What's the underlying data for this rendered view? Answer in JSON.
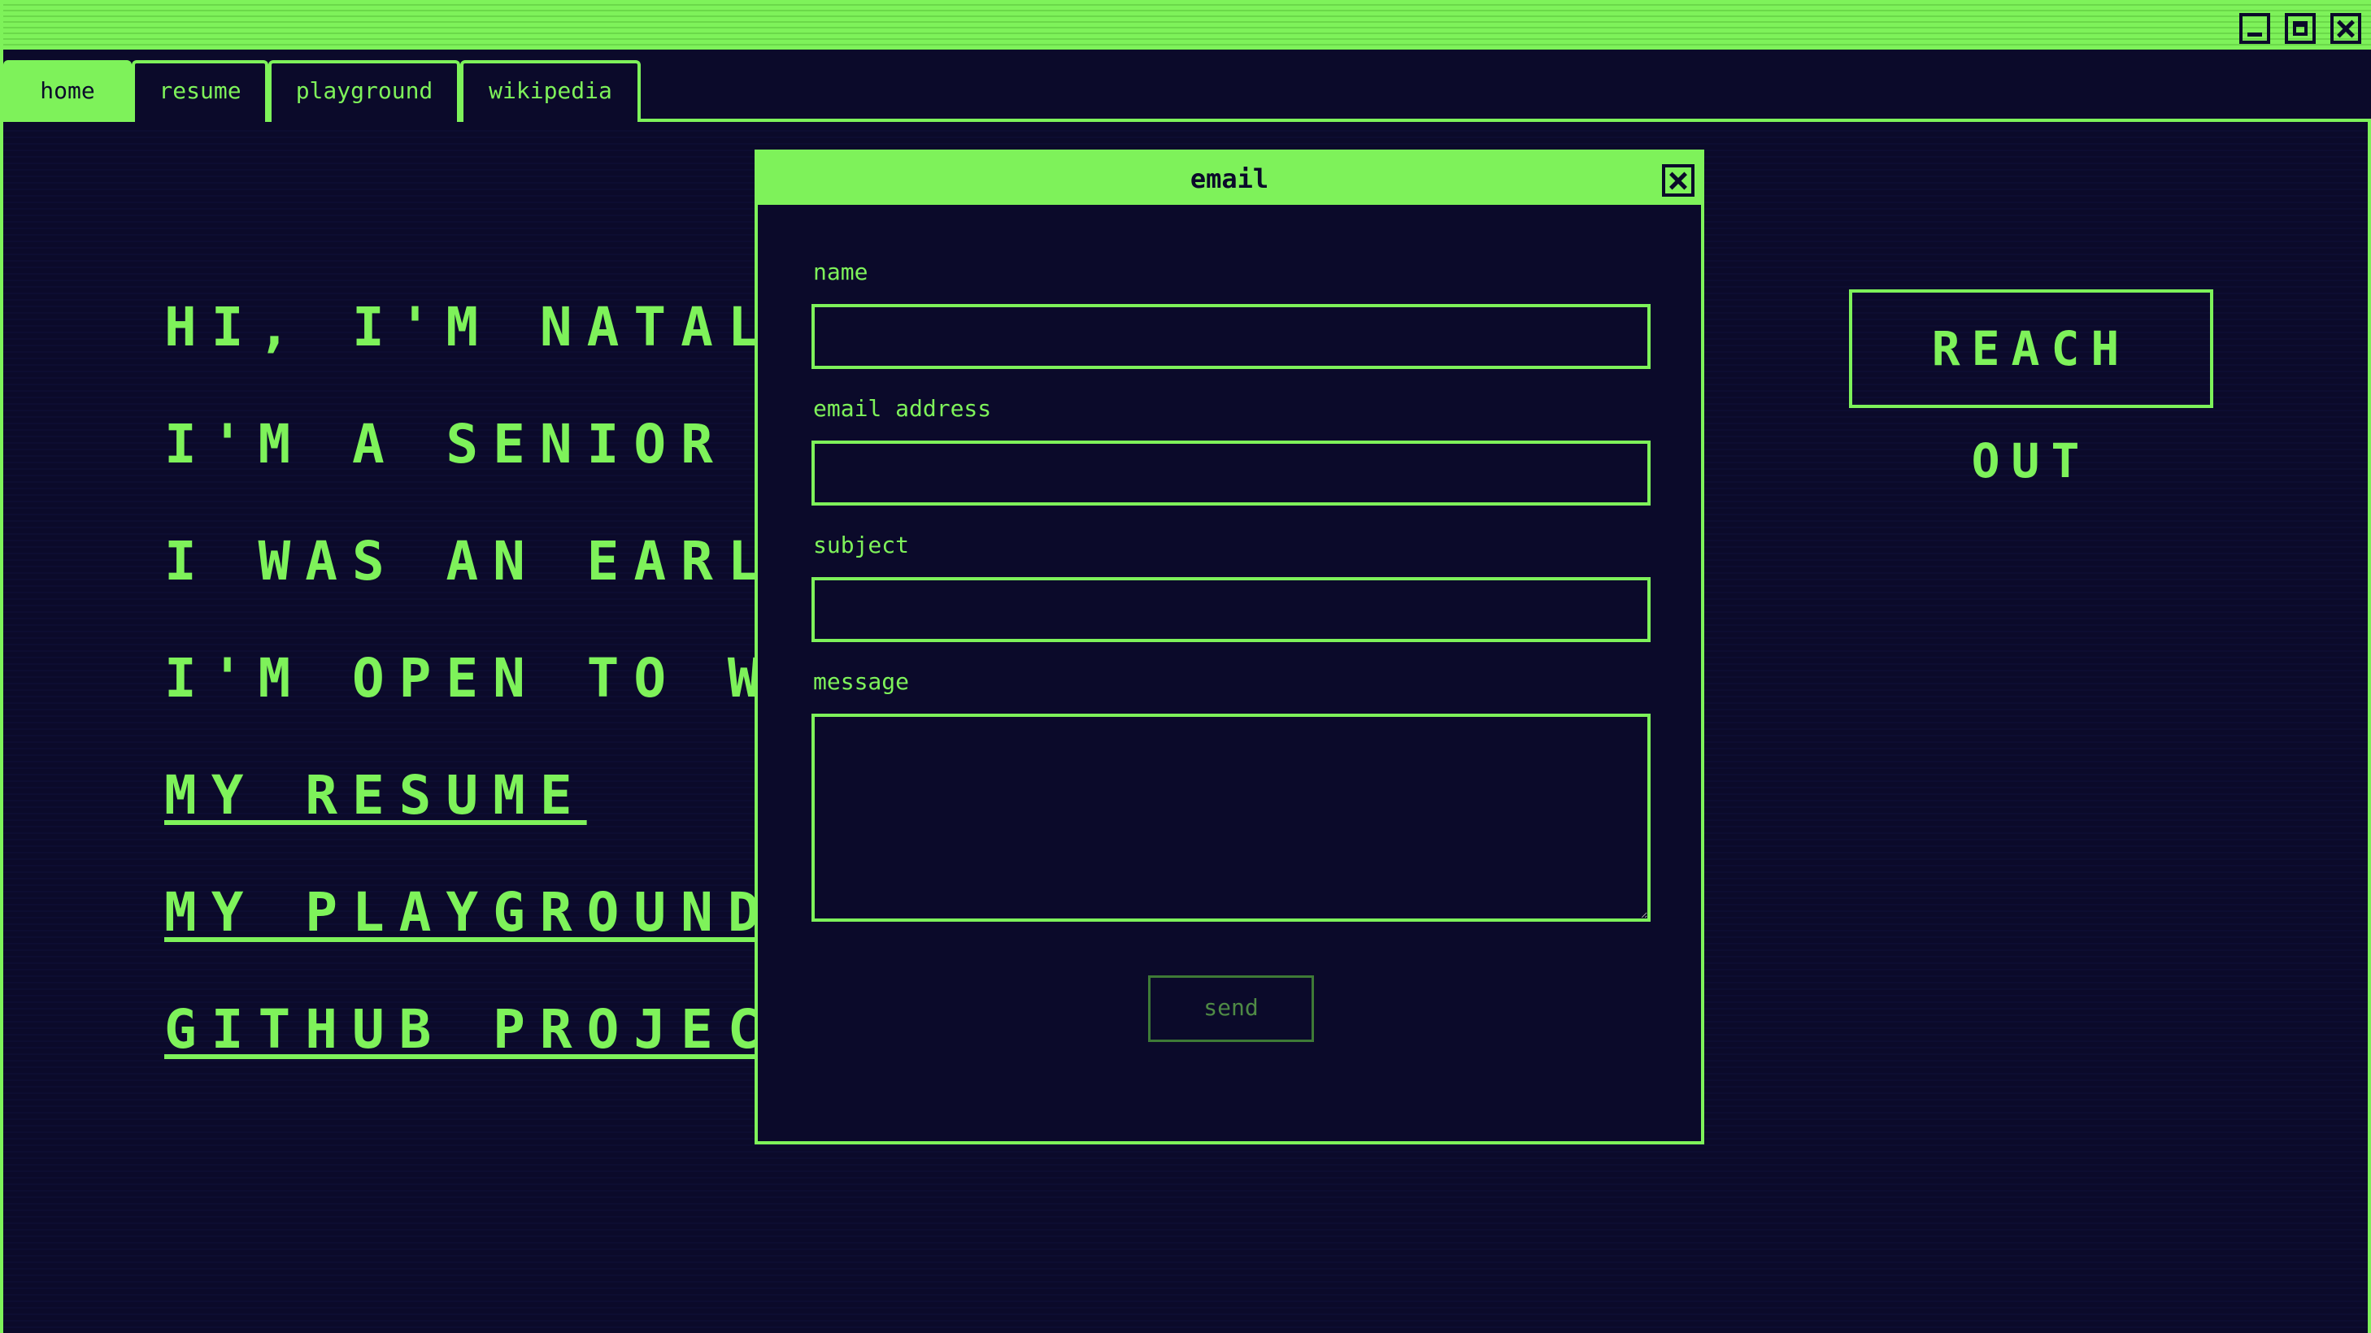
{
  "window": {
    "controls": [
      "minimize-icon",
      "maximize-icon",
      "close-icon"
    ]
  },
  "tabs": [
    {
      "label": "home",
      "active": true
    },
    {
      "label": "resume",
      "active": false
    },
    {
      "label": "playground",
      "active": false
    },
    {
      "label": "wikipedia",
      "active": false
    }
  ],
  "content": {
    "lines": [
      "HI, I'M NATALIE P",
      "I'M A SENIOR FRO",
      "I WAS AN EARLY",
      "I'M OPEN TO WORK"
    ],
    "links": [
      "MY RESUME",
      "MY PLAYGROUND",
      "GITHUB PROJECT"
    ],
    "reach_out": "REACH OUT"
  },
  "modal": {
    "title": "email",
    "fields": {
      "name_label": "name",
      "name_value": "",
      "email_label": "email address",
      "email_value": "",
      "subject_label": "subject",
      "subject_value": "",
      "message_label": "message",
      "message_value": ""
    },
    "send_label": "send"
  },
  "colors": {
    "accent": "#7ef25a",
    "background": "#0b0a2a",
    "disabled": "#4f8a45"
  }
}
